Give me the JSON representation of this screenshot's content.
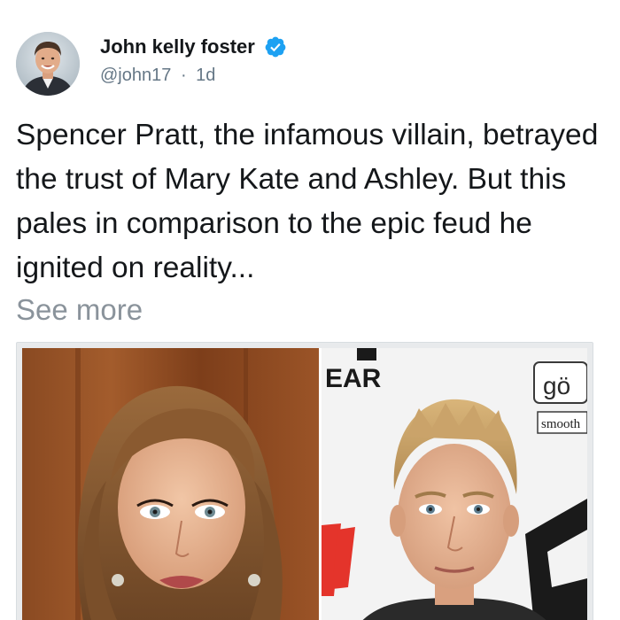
{
  "author": {
    "name": "John kelly foster",
    "handle": "@john17",
    "separator": "·",
    "time": "1d",
    "verified": true
  },
  "tweet": {
    "text": "Spencer Pratt, the infamous villain, betrayed the trust of Mary Kate and Ashley. But this pales in comparison to the epic feud he ignited on reality...",
    "see_more": "See more"
  },
  "media": {
    "right_backdrop_text": {
      "ear": "EAR",
      "go": "gö",
      "smooth": "smooth"
    }
  },
  "colors": {
    "text": "#14171a",
    "secondary": "#657786",
    "see_more": "#8a939b",
    "verified": "#1da1f2"
  },
  "icons": {
    "verified": "verified-badge-icon"
  }
}
